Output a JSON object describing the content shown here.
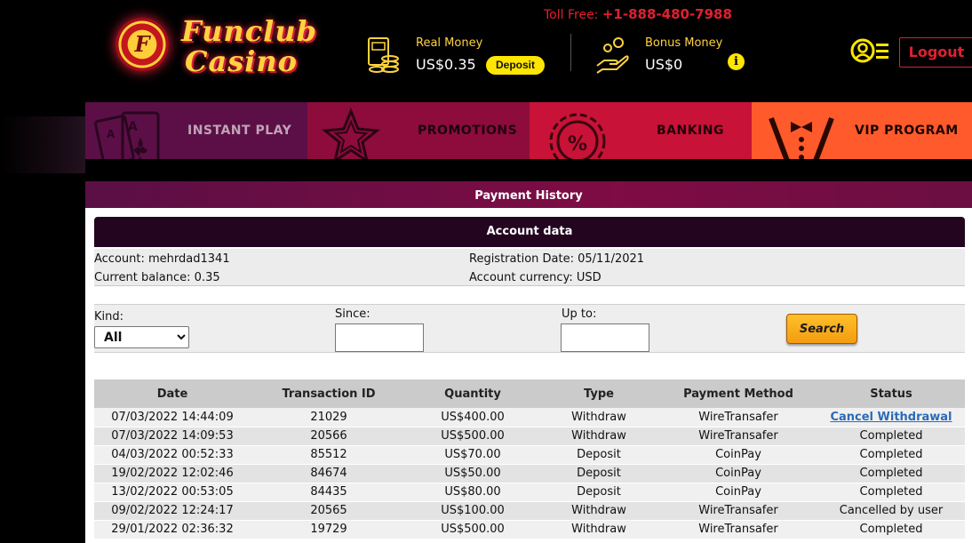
{
  "header": {
    "logo_chip_letter": "F",
    "logo_line_1": "Funclub",
    "logo_line_2": "Casino",
    "toll_free_label": "Toll Free:",
    "toll_free_number": "+1-888-480-7988",
    "real_money_label": "Real Money",
    "real_money_value": "US$0.35",
    "deposit_label": "Deposit",
    "bonus_money_label": "Bonus Money",
    "bonus_money_value": "US$0",
    "info_glyph": "i",
    "logout_label": "Logout",
    "colors": {
      "gold": "#ffd23e",
      "red": "#e02030",
      "deposit_bg": "#ffe600"
    }
  },
  "nav": {
    "items": [
      {
        "label": "INSTANT PLAY",
        "icon": "playing-cards-icon",
        "color": "#5c0f46"
      },
      {
        "label": "PROMOTIONS",
        "icon": "star-icon",
        "color": "#8d0c3b"
      },
      {
        "label": "BANKING",
        "icon": "percent-badge-icon",
        "color": "#c81237"
      },
      {
        "label": "VIP PROGRAM",
        "icon": "tuxedo-icon",
        "color": "#ff5a2c"
      }
    ]
  },
  "page": {
    "title": "Payment History"
  },
  "account": {
    "section_title": "Account data",
    "account_label": "Account:",
    "account_value": "mehrdad1341",
    "registration_label": "Registration Date:",
    "registration_value": "05/11/2021",
    "balance_label": "Current balance:",
    "balance_value": "0.35",
    "currency_label": "Account currency:",
    "currency_value": "USD"
  },
  "filters": {
    "kind_label": "Kind:",
    "kind_selected": "All",
    "since_label": "Since:",
    "since_value": "",
    "upto_label": "Up to:",
    "upto_value": "",
    "search_label": "Search"
  },
  "table": {
    "columns": [
      "Date",
      "Transaction ID",
      "Quantity",
      "Type",
      "Payment Method",
      "Status"
    ],
    "rows": [
      {
        "date": "07/03/2022 14:44:09",
        "id": "21029",
        "quantity": "US$400.00",
        "type": "Withdraw",
        "method": "WireTransafer",
        "status": "Cancel Withdrawal",
        "status_link": true
      },
      {
        "date": "07/03/2022 14:09:53",
        "id": "20566",
        "quantity": "US$500.00",
        "type": "Withdraw",
        "method": "WireTransafer",
        "status": "Completed",
        "status_link": false
      },
      {
        "date": "04/03/2022 00:52:33",
        "id": "85512",
        "quantity": "US$70.00",
        "type": "Deposit",
        "method": "CoinPay",
        "status": "Completed",
        "status_link": false
      },
      {
        "date": "19/02/2022 12:02:46",
        "id": "84674",
        "quantity": "US$50.00",
        "type": "Deposit",
        "method": "CoinPay",
        "status": "Completed",
        "status_link": false
      },
      {
        "date": "13/02/2022 00:53:05",
        "id": "84435",
        "quantity": "US$80.00",
        "type": "Deposit",
        "method": "CoinPay",
        "status": "Completed",
        "status_link": false
      },
      {
        "date": "09/02/2022 12:24:17",
        "id": "20565",
        "quantity": "US$100.00",
        "type": "Withdraw",
        "method": "WireTransafer",
        "status": "Cancelled by user",
        "status_link": false
      },
      {
        "date": "29/01/2022 02:36:32",
        "id": "19729",
        "quantity": "US$500.00",
        "type": "Withdraw",
        "method": "WireTransafer",
        "status": "Completed",
        "status_link": false
      }
    ]
  }
}
